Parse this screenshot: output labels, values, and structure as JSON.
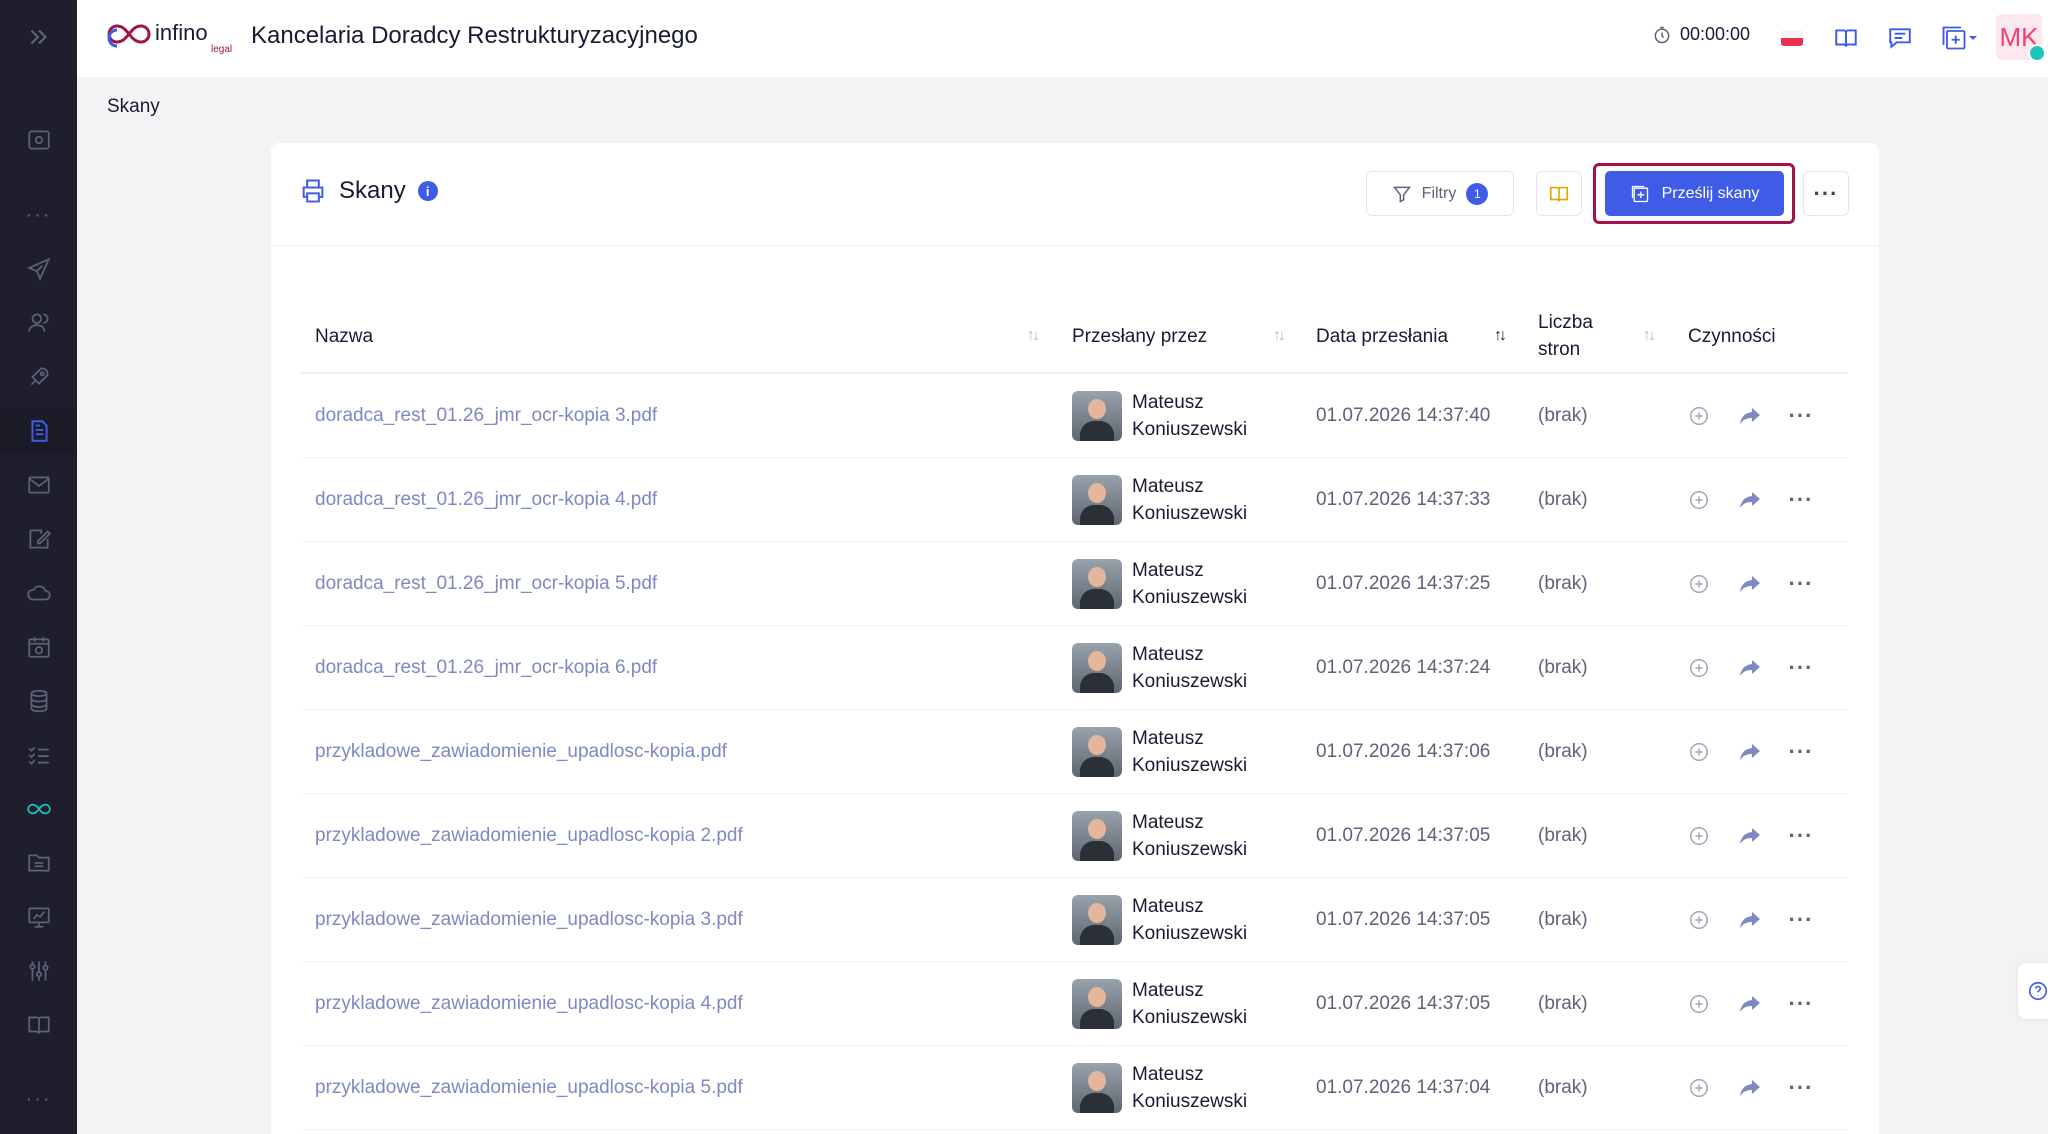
{
  "header": {
    "app_title": "Kancelaria Doradcy Restrukturyzacyjnego",
    "logo_text": "infino",
    "logo_subtext": "legal",
    "timer": "00:00:00",
    "user_initials": "MK"
  },
  "breadcrumb": "Skany",
  "card": {
    "title": "Skany",
    "info": "i",
    "filter_label": "Filtry",
    "filter_count": "1",
    "upload_label": "Prześlij skany",
    "more_label": "···"
  },
  "table": {
    "columns": [
      "Nazwa",
      "Przesłany przez",
      "Data przesłania",
      "Liczba",
      "stron",
      "Czynności"
    ],
    "rows": [
      {
        "name": "doradca_rest_01.26_jmr_ocr-kopia 3.pdf",
        "user_first": "Mateusz",
        "user_last": "Koniuszewski",
        "date": "01.07.2026 14:37:40",
        "pages": "(brak)"
      },
      {
        "name": "doradca_rest_01.26_jmr_ocr-kopia 4.pdf",
        "user_first": "Mateusz",
        "user_last": "Koniuszewski",
        "date": "01.07.2026 14:37:33",
        "pages": "(brak)"
      },
      {
        "name": "doradca_rest_01.26_jmr_ocr-kopia 5.pdf",
        "user_first": "Mateusz",
        "user_last": "Koniuszewski",
        "date": "01.07.2026 14:37:25",
        "pages": "(brak)"
      },
      {
        "name": "doradca_rest_01.26_jmr_ocr-kopia 6.pdf",
        "user_first": "Mateusz",
        "user_last": "Koniuszewski",
        "date": "01.07.2026 14:37:24",
        "pages": "(brak)"
      },
      {
        "name": "przykladowe_zawiadomienie_upadlosc-kopia.pdf",
        "user_first": "Mateusz",
        "user_last": "Koniuszewski",
        "date": "01.07.2026 14:37:06",
        "pages": "(brak)"
      },
      {
        "name": "przykladowe_zawiadomienie_upadlosc-kopia 2.pdf",
        "user_first": "Mateusz",
        "user_last": "Koniuszewski",
        "date": "01.07.2026 14:37:05",
        "pages": "(brak)"
      },
      {
        "name": "przykladowe_zawiadomienie_upadlosc-kopia 3.pdf",
        "user_first": "Mateusz",
        "user_last": "Koniuszewski",
        "date": "01.07.2026 14:37:05",
        "pages": "(brak)"
      },
      {
        "name": "przykladowe_zawiadomienie_upadlosc-kopia 4.pdf",
        "user_first": "Mateusz",
        "user_last": "Koniuszewski",
        "date": "01.07.2026 14:37:05",
        "pages": "(brak)"
      },
      {
        "name": "przykladowe_zawiadomienie_upadlosc-kopia 5.pdf",
        "user_first": "Mateusz",
        "user_last": "Koniuszewski",
        "date": "01.07.2026 14:37:04",
        "pages": "(brak)"
      }
    ]
  },
  "sidebar": {
    "items": [
      "expand-icon",
      "dashboard-icon",
      "send-icon",
      "users-icon",
      "rocket-icon",
      "document-icon",
      "mail-icon",
      "edit-icon",
      "cloud-icon",
      "calendar-icon",
      "database-icon",
      "tasks-icon",
      "infinity-icon",
      "folder-icon",
      "chart-icon",
      "settings-icon",
      "book-icon"
    ]
  },
  "colors": {
    "primary": "#3f5ce6",
    "sidebar_bg": "#1e1e2d",
    "highlight_frame": "#a0144a",
    "link": "#7e88c3",
    "brand_red": "#f1416c"
  }
}
